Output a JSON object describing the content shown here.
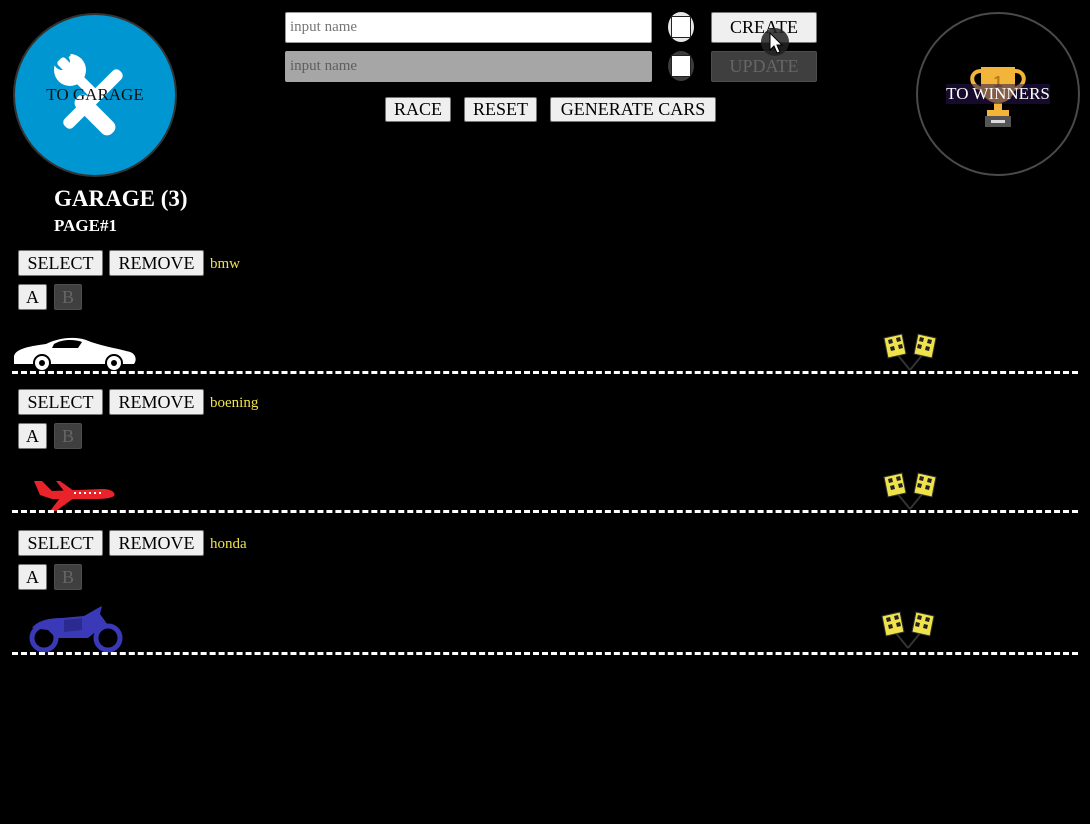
{
  "nav": {
    "garage_label": "TO GARAGE",
    "winners_label": "TO WINNERS"
  },
  "create": {
    "placeholder": "input name",
    "button": "CREATE",
    "color": "#ffffff"
  },
  "update": {
    "placeholder": "input name",
    "button": "UPDATE",
    "color": "#ffffff"
  },
  "controls": {
    "race": "RACE",
    "reset": "RESET",
    "generate": "GENERATE CARS"
  },
  "garage": {
    "title": "GARAGE (3)",
    "page": "PAGE#1"
  },
  "cars": [
    {
      "name": "bmw",
      "select": "SELECT",
      "remove": "REMOVE",
      "start": "A",
      "stop": "B",
      "icon": "car-icon",
      "color": "#ffffff"
    },
    {
      "name": "boening",
      "select": "SELECT",
      "remove": "REMOVE",
      "start": "A",
      "stop": "B",
      "icon": "plane-icon",
      "color": "#e8232a"
    },
    {
      "name": "honda",
      "select": "SELECT",
      "remove": "REMOVE",
      "start": "A",
      "stop": "B",
      "icon": "motorcycle-icon",
      "color": "#3a3ab8"
    }
  ],
  "colors": {
    "background": "#000000",
    "garage_circle": "#0096d1",
    "car_name": "#f0e24a",
    "trophy": "#f2b53a"
  }
}
